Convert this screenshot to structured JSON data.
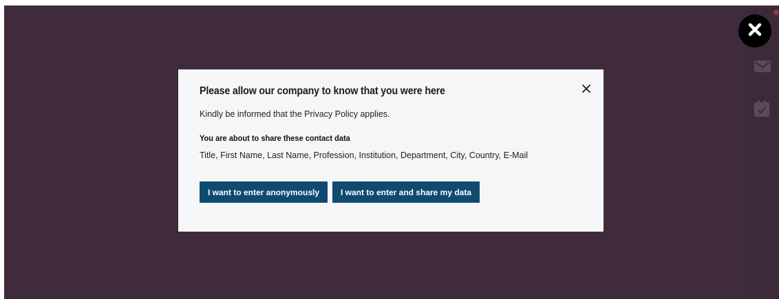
{
  "modal": {
    "title": "Please allow our company to know that you were here",
    "description": "Kindly be informed that the Privacy Policy applies.",
    "contact_heading": "You are about to share these contact data",
    "contact_fields": "Title, First Name, Last Name, Profession, Institution, Department, City, Country, E-Mail",
    "buttons": {
      "anonymous": "I want to enter anonymously",
      "share": "I want to enter and share my data"
    }
  },
  "icons": {
    "overlay_close": "close-icon",
    "modal_close": "close-icon",
    "rail": [
      "mail-icon",
      "calendar-check-icon"
    ]
  },
  "colors": {
    "backdrop": "#3f2b3b",
    "modal_bg": "#f4f6f8",
    "button_bg": "#0f4a70",
    "button_text": "#ffffff"
  }
}
